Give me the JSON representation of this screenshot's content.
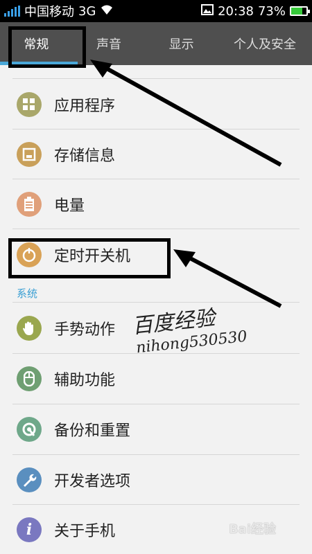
{
  "status_bar": {
    "carrier": "中国移动",
    "network": "3G",
    "time": "20:38",
    "battery": "73%",
    "battery_level": 0.73
  },
  "tabs": [
    {
      "label": "常规",
      "active": true
    },
    {
      "label": "声音",
      "active": false
    },
    {
      "label": "显示",
      "active": false
    },
    {
      "label": "个人及安全",
      "active": false
    }
  ],
  "general_items": [
    {
      "label": "应用程序",
      "icon": "apps-grid-icon",
      "color": "#a9a76a"
    },
    {
      "label": "存储信息",
      "icon": "storage-icon",
      "color": "#c9a05a"
    },
    {
      "label": "电量",
      "icon": "battery-icon",
      "color": "#e0a07a"
    },
    {
      "label": "定时开关机",
      "icon": "timer-power-icon",
      "color": "#d9a256"
    }
  ],
  "section_system": "系统",
  "system_items": [
    {
      "label": "手势动作",
      "icon": "hand-icon",
      "color": "#9aa74f"
    },
    {
      "label": "辅助功能",
      "icon": "mouse-icon",
      "color": "#6f9f72"
    },
    {
      "label": "备份和重置",
      "icon": "backup-icon",
      "color": "#6fa88a"
    },
    {
      "label": "开发者选项",
      "icon": "wrench-icon",
      "color": "#5a8fbf"
    },
    {
      "label": "关于手机",
      "icon": "info-icon",
      "color": "#7a78c0"
    }
  ],
  "watermark": {
    "title": "百度经验",
    "user": "nihong530530"
  },
  "baidu_logo": "Bai经验"
}
